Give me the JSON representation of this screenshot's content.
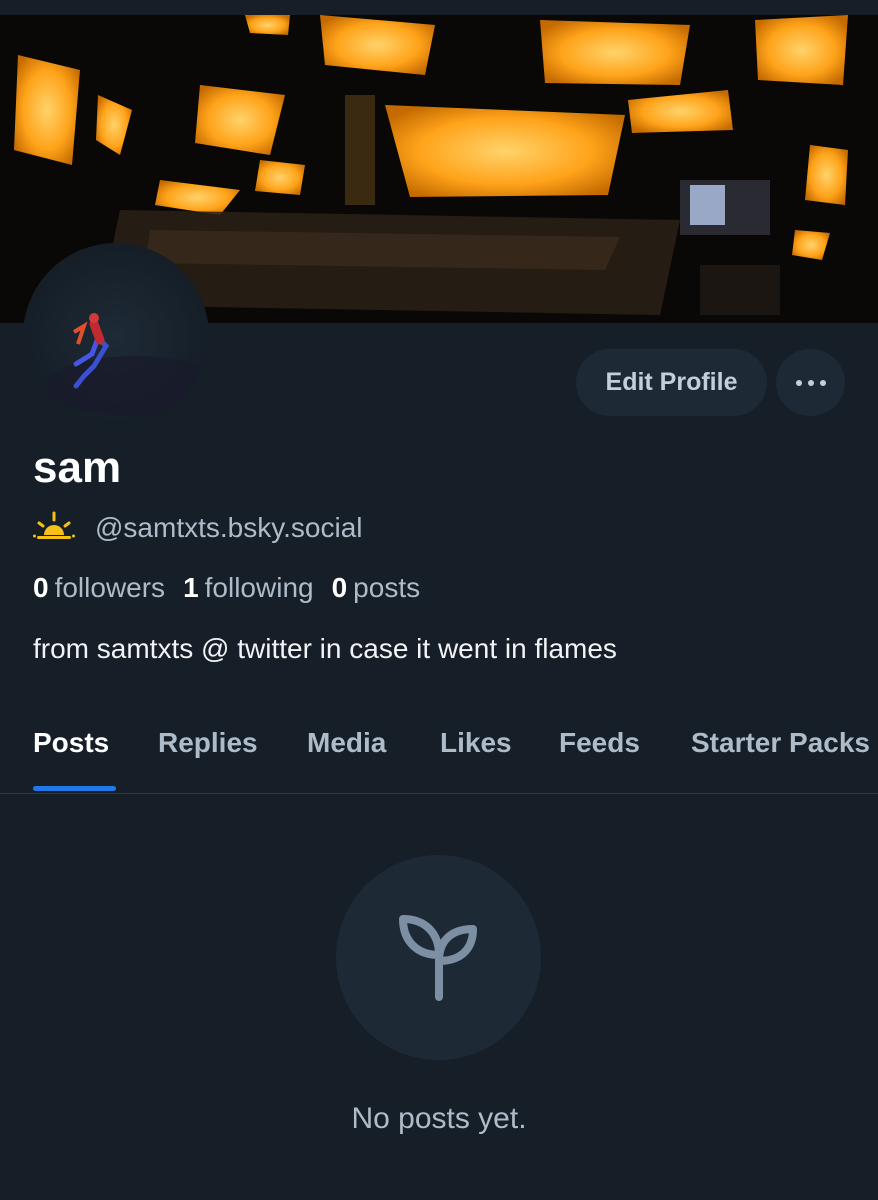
{
  "profile": {
    "display_name": "sam",
    "handle": "@samtxts.bsky.social",
    "bio": "from samtxts @ twitter in case it went in flames",
    "handle_icon": "sunrise-icon"
  },
  "actions": {
    "edit_label": "Edit Profile",
    "more_icon": "ellipsis-icon"
  },
  "stats": {
    "followers_count": "0",
    "followers_label": "followers",
    "following_count": "1",
    "following_label": "following",
    "posts_count": "0",
    "posts_label": "posts"
  },
  "tabs": [
    {
      "label": "Posts",
      "active": true
    },
    {
      "label": "Replies",
      "active": false
    },
    {
      "label": "Media",
      "active": false
    },
    {
      "label": "Likes",
      "active": false
    },
    {
      "label": "Feeds",
      "active": false
    },
    {
      "label": "Starter Packs",
      "active": false
    }
  ],
  "empty_state": {
    "icon": "seedling-icon",
    "text": "No posts yet."
  },
  "colors": {
    "background": "#161e27",
    "accent": "#2079e6",
    "button_bg": "#1e2936",
    "banner_glow": "#ffa31a"
  }
}
